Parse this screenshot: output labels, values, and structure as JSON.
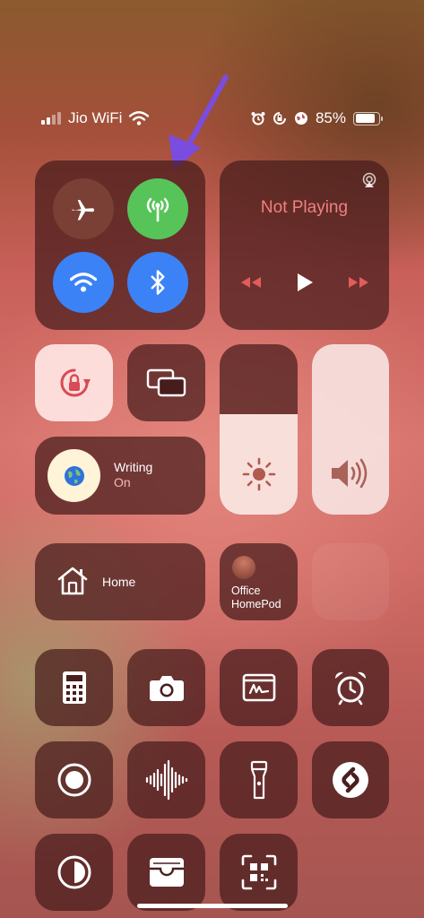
{
  "status_bar": {
    "carrier": "Jio WiFi",
    "battery_percent": "85%",
    "battery_level": 0.85
  },
  "connectivity": {
    "airplane": "airplane-icon",
    "cellular": "cellular-antenna-icon",
    "wifi": "wifi-icon",
    "bluetooth": "bluetooth-icon"
  },
  "media": {
    "status": "Not Playing"
  },
  "focus": {
    "title": "Writing",
    "state": "On"
  },
  "home": {
    "label": "Home"
  },
  "homepod": {
    "line1": "Office",
    "line2": "HomePod"
  },
  "brightness_level": 0.59,
  "volume_level": 1.0,
  "colors": {
    "cellular_green": "#57c45a",
    "blue": "#3b82f6",
    "airplane_bg": "#7a4036",
    "media_red": "#f08080",
    "annotation_arrow": "#7b4ce0"
  }
}
